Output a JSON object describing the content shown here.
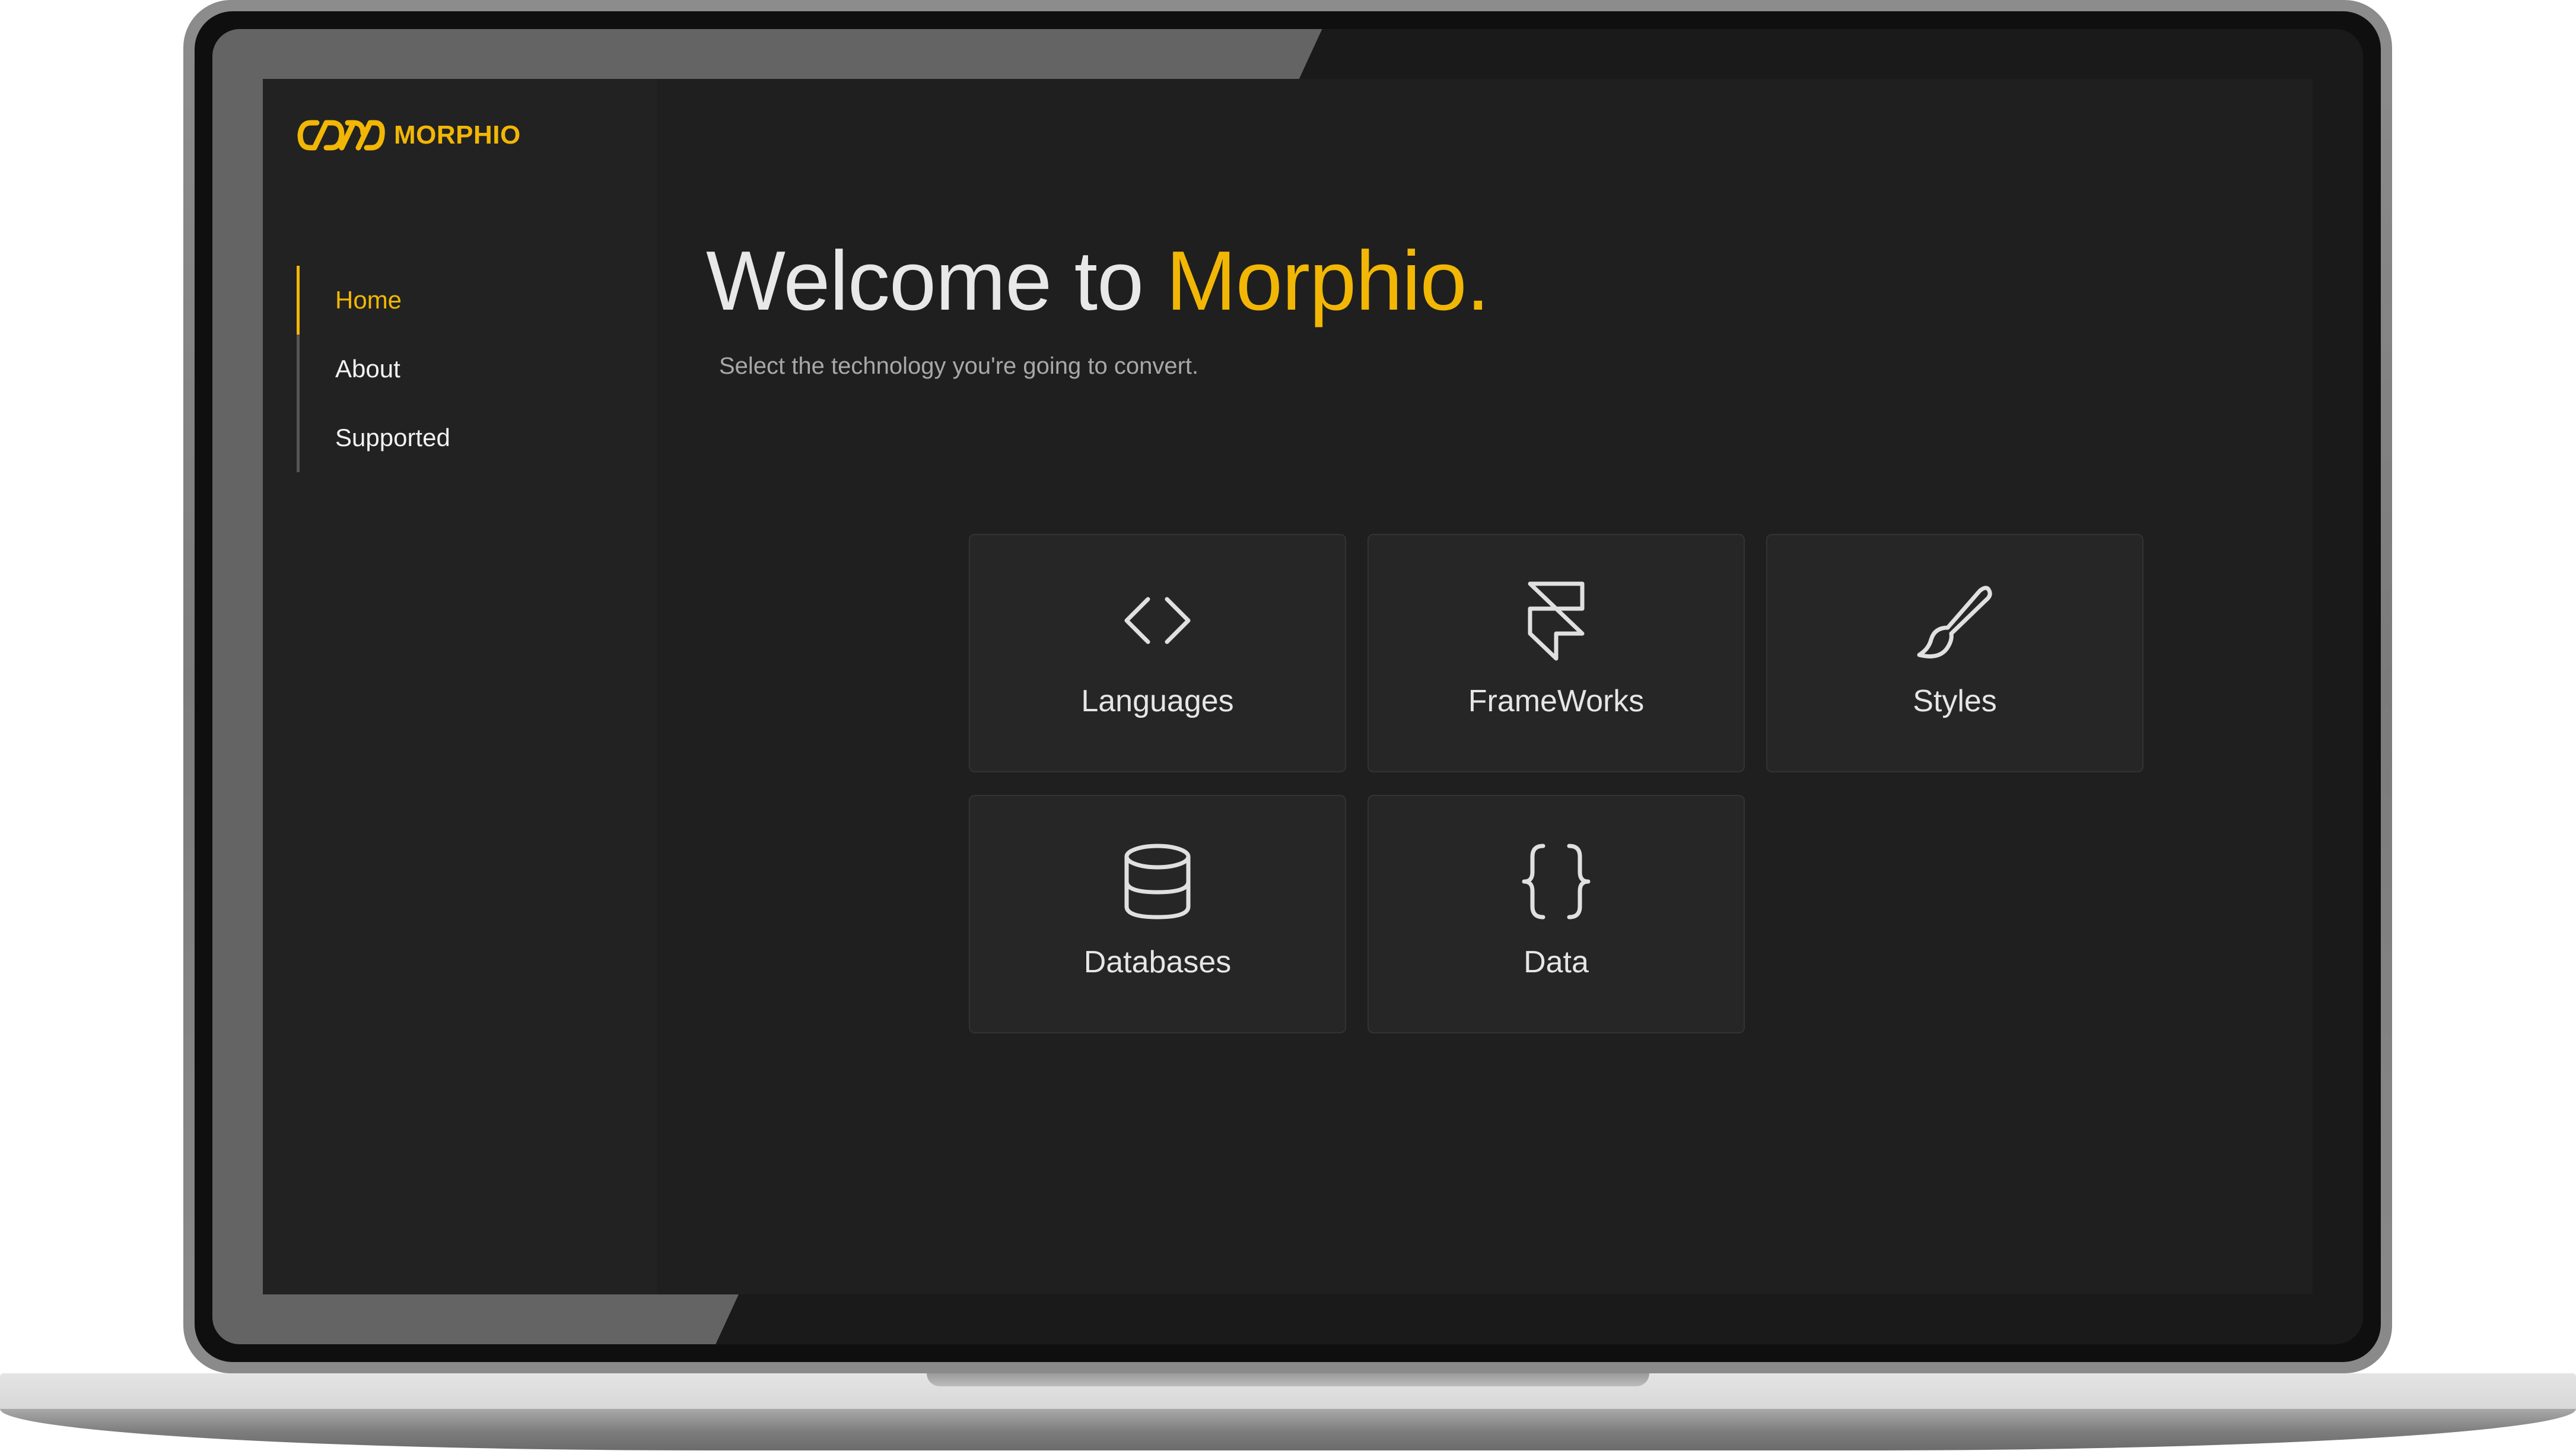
{
  "app": {
    "logo_text": "MORPHIO",
    "accent_color": "#f2b705",
    "background_color": "#1f1f1f",
    "sidebar_color": "#222222"
  },
  "sidebar": {
    "items": [
      {
        "label": "Home",
        "active": true
      },
      {
        "label": "About",
        "active": false
      },
      {
        "label": "Supported",
        "active": false
      }
    ]
  },
  "main": {
    "title_prefix": "Welcome to ",
    "title_accent": "Morphio.",
    "subtitle": "Select the technology you're going to convert.",
    "tiles": [
      {
        "label": "Languages",
        "icon": "code-brackets-icon"
      },
      {
        "label": "FrameWorks",
        "icon": "framer-icon"
      },
      {
        "label": "Styles",
        "icon": "paintbrush-icon"
      },
      {
        "label": "Databases",
        "icon": "database-icon"
      },
      {
        "label": "Data",
        "icon": "curly-braces-icon"
      }
    ]
  }
}
